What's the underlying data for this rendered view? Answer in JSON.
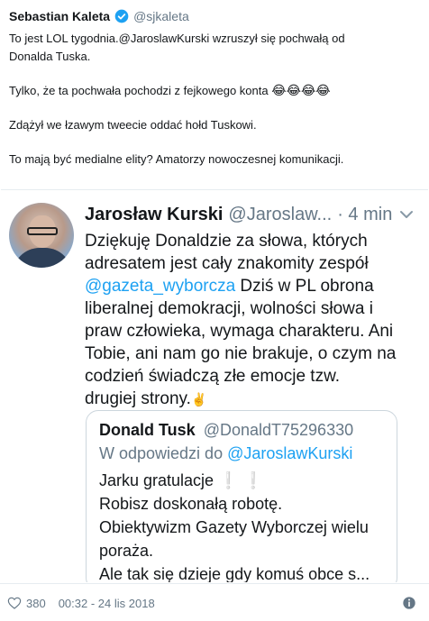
{
  "tweet": {
    "author_name": "Sebastian Kaleta",
    "author_handle": "@sjkaleta",
    "lines": {
      "l1": "To jest LOL tygodnia.@JaroslawKurski wzruszył się pochwałą od",
      "l2": "Donalda Tuska.",
      "l3_text": "Tylko, że ta pochwała pochodzi z fejkowego konta ",
      "l3_emoji": "😂😂😂😂",
      "l4": "Zdążył we łzawym tweecie oddać hołd Tuskowi.",
      "l5": "To mają być medialne elity? Amatorzy nowoczesnej komunikacji."
    },
    "likes": "380",
    "timestamp": "00:32 - 24 lis 2018",
    "icons": [
      "verified-badge-icon",
      "heart-icon",
      "info-icon"
    ]
  },
  "embedded_screenshot": {
    "author_name": "Jarosław Kurski",
    "author_handle": "@Jaroslaw...",
    "time": "· 4 min",
    "lines": {
      "l1": "Dziękuję Donaldzie za słowa, których",
      "l2": "adresatem jest cały znakomity zespół",
      "l3_mention": "@gazeta_wyborcza",
      "l3_text": " Dziś w PL obrona",
      "l4": "liberalnej demokracji, wolności słowa i",
      "l5": "praw człowieka, wymaga charakteru. Ani",
      "l6": "Tobie, ani nam go nie brakuje, o czym na",
      "l7": "codzień świadczą złe emocje tzw.",
      "l8": "drugiej strony.",
      "l8_emoji": "✌️"
    },
    "quote": {
      "author_name": "Donald Tusk",
      "author_handle": "@DonaldT75296330",
      "reply_prefix": "W odpowiedzi do ",
      "reply_mention": "@JaroslawKurski",
      "lines": {
        "l1": "Jarku gratulacje",
        "l1_excl": " ❕ ❕",
        "l2": "Robisz doskonałą robotę.",
        "l3": "Obiektywizm Gazety Wyborczej wielu",
        "l4": "poraża.",
        "l5": "Ale tak się dzieje gdy komuś obce s..."
      }
    },
    "icons": [
      "avatar-photo",
      "chevron-down-icon"
    ]
  },
  "colors": {
    "link": "#1da1f2",
    "secondary_text": "#657786",
    "divider": "#e6ecf0"
  }
}
